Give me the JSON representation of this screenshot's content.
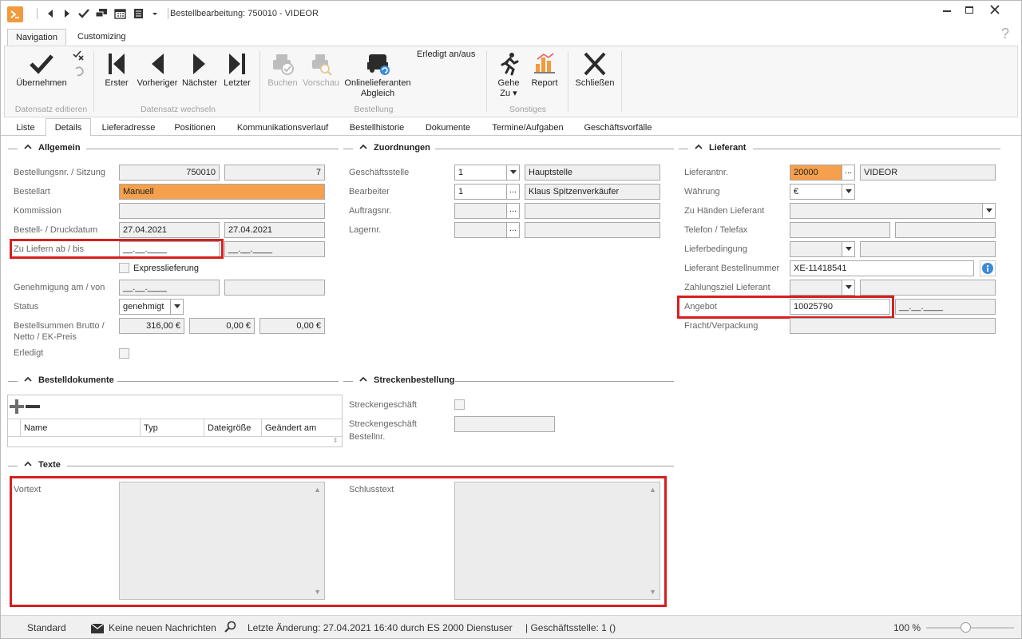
{
  "window": {
    "title": "Bestellbearbeitung: 750010 - VIDEOR",
    "help": "?"
  },
  "ribbon_tabs": [
    "Navigation",
    "Customizing"
  ],
  "ribbon": {
    "buttons": {
      "uebernehmen": "Übernehmen",
      "erster": "Erster",
      "vorheriger": "Vorheriger",
      "naechster": "Nächster",
      "letzter": "Letzter",
      "buchen": "Buchen",
      "vorschau": "Vorschau",
      "online_line1": "Onlinelieferanten",
      "online_line2": "Abgleich",
      "erledigt": "Erledigt an/aus",
      "gehe_line1": "Gehe",
      "gehe_line2": "Zu ▾",
      "report": "Report",
      "schliessen": "Schließen"
    },
    "groups": {
      "datensatz_editieren": "Datensatz editieren",
      "datensatz_wechseln": "Datensatz wechseln",
      "bestellung": "Bestellung",
      "sonstiges": "Sonstiges"
    }
  },
  "page_tabs": [
    "Liste",
    "Details",
    "Lieferadresse",
    "Positionen",
    "Kommunikationsverlauf",
    "Bestellhistorie",
    "Dokumente",
    "Termine/Aufgaben",
    "Geschäftsvorfälle"
  ],
  "allgemein": {
    "header": "Allgemein",
    "bestellungsnr_label": "Bestellungsnr. / Sitzung",
    "bestellungsnr": "750010",
    "sitzung": "7",
    "bestellart_label": "Bestellart",
    "bestellart": "Manuell",
    "kommission_label": "Kommission",
    "kommission": "",
    "bestelldatum_label": "Bestell- / Druckdatum",
    "bestelldatum": "27.04.2021",
    "druckdatum": "27.04.2021",
    "zu_liefern_label": "Zu Liefern ab / bis",
    "zu_liefern_ab": "__.__.____",
    "zu_liefern_bis": "__.__.____",
    "express_label": "Expresslieferung",
    "genehmigung_label": "Genehmigung am / von",
    "genehmigung_am": "__.__.____",
    "genehmigung_von": "",
    "status_label": "Status",
    "status": "genehmigt",
    "summen_label_1": "Bestellsummen Brutto /",
    "summen_label_2": "Netto / EK-Preis",
    "brutto": "316,00 €",
    "netto": "0,00 €",
    "ek_preis": "0,00 €",
    "erledigt_label": "Erledigt"
  },
  "zuordnungen": {
    "header": "Zuordnungen",
    "geschaeftsstelle_label": "Geschäftsstelle",
    "geschaeftsstelle_nr": "1",
    "geschaeftsstelle_name": "Hauptstelle",
    "bearbeiter_label": "Bearbeiter",
    "bearbeiter_nr": "1",
    "bearbeiter_name": "Klaus Spitzenverkäufer",
    "auftragsnr_label": "Auftragsnr.",
    "lagernr_label": "Lagernr."
  },
  "lieferant": {
    "header": "Lieferant",
    "lieferantnr_label": "Lieferantnr.",
    "lieferantnr": "20000",
    "lieferant_name": "VIDEOR",
    "waehrung_label": "Währung",
    "waehrung": "€",
    "zu_haenden_label": "Zu Händen Lieferant",
    "telefon_label": "Telefon / Telefax",
    "lieferbedingung_label": "Lieferbedingung",
    "bestellnummer_label": "Lieferant Bestellnummer",
    "bestellnummer": "XE-11418541",
    "zahlungsziel_label": "Zahlungsziel Lieferant",
    "angebot_label": "Angebot",
    "angebot": "10025790",
    "angebot_datum": "__.__.____",
    "fracht_label": "Fracht/Verpackung"
  },
  "bestelldokumente": {
    "header": "Bestelldokumente",
    "columns": [
      "Name",
      "Typ",
      "Dateigröße",
      "Geändert am"
    ]
  },
  "streckenbestellung": {
    "header": "Streckenbestellung",
    "streckengeschaeft_label": "Streckengeschäft",
    "bestellnr_label_1": "Streckengeschäft",
    "bestellnr_label_2": "Bestellnr."
  },
  "texte": {
    "header": "Texte",
    "vortext_label": "Vortext",
    "schlusstext_label": "Schlusstext"
  },
  "statusbar": {
    "standard": "Standard",
    "nachrichten": "Keine neuen Nachrichten",
    "letzte_aenderung": "Letzte Änderung: 27.04.2021 16:40 durch ES 2000 Dienstuser",
    "geschaeftsstelle": "| Geschäftsstelle:  1 ()",
    "zoom": "100 %"
  },
  "colors": {
    "accent_orange": "#f5a04c",
    "highlight_red": "#d61f1f"
  }
}
